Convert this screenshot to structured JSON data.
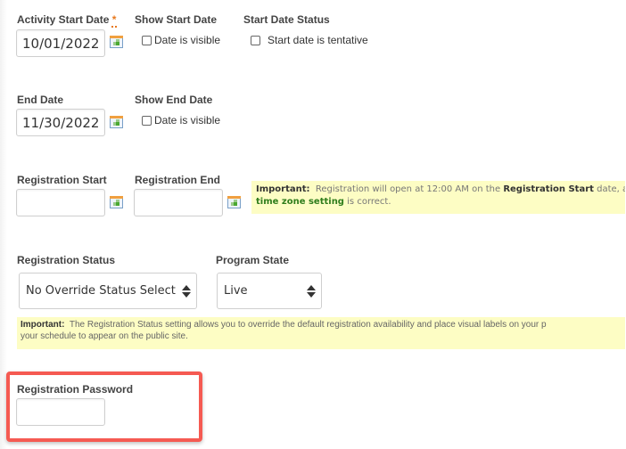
{
  "start_date": {
    "label": "Activity Start Date",
    "required_mark": "*",
    "value": "10/01/2022"
  },
  "show_start_date": {
    "label": "Show Start Date",
    "checkbox_label": "Date is visible",
    "checked": false
  },
  "start_date_status": {
    "label": "Start Date Status",
    "checkbox_label": "Start date is tentative",
    "checked": false
  },
  "end_date": {
    "label": "End Date",
    "value": "11/30/2022"
  },
  "show_end_date": {
    "label": "Show End Date",
    "checkbox_label": "Date is visible",
    "checked": false
  },
  "registration_start": {
    "label": "Registration Start",
    "value": ""
  },
  "registration_end": {
    "label": "Registration End",
    "value": ""
  },
  "registration_note": {
    "prefix": "Important:",
    "text1": "Registration will open at 12:00 AM on the",
    "bold": "Registration Start",
    "text2": "date, and",
    "link": "time zone setting",
    "text3": "is correct."
  },
  "registration_status": {
    "label": "Registration Status",
    "selected": "No Override Status Select"
  },
  "program_state": {
    "label": "Program State",
    "selected": "Live"
  },
  "status_note": {
    "prefix": "Important:",
    "line1": "The Registration Status setting allows you to override the default registration availability and place visual labels on your p",
    "line2": "your schedule to appear on the public site."
  },
  "registration_password": {
    "label": "Registration Password",
    "value": ""
  },
  "colors": {
    "highlight_border": "#f55a52",
    "note_background": "#fdfdc4",
    "required_mark": "#e8791e",
    "link_green": "#2f7d1c"
  }
}
